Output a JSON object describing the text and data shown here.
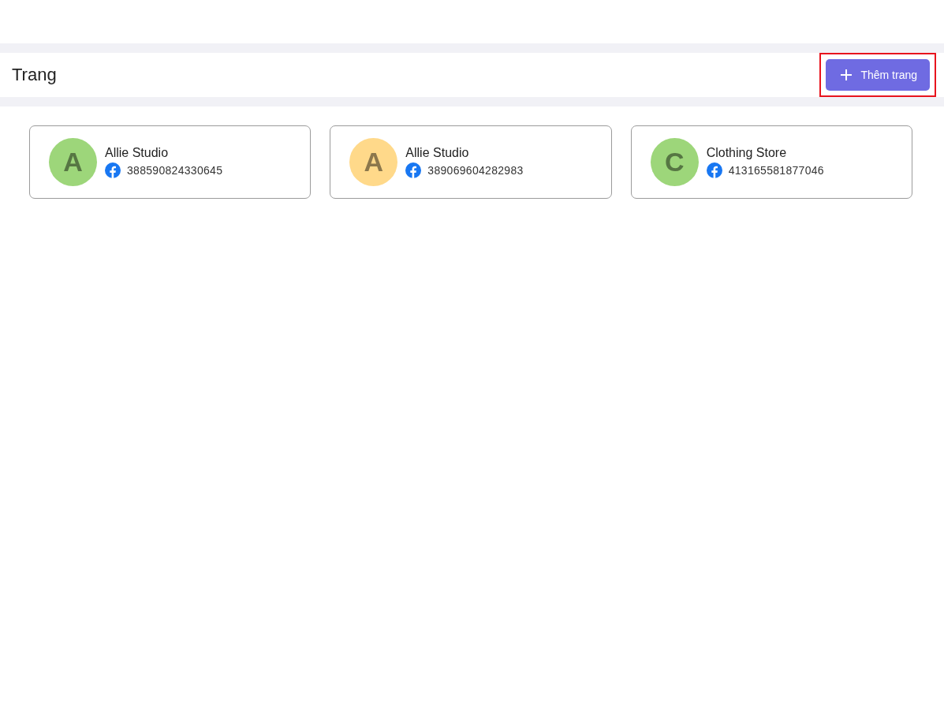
{
  "header": {
    "title": "Trang",
    "add_button": {
      "label": "Thêm trang",
      "highlighted": true
    }
  },
  "pages": [
    {
      "avatar_letter": "A",
      "color": "#9dd67a",
      "name": "Allie Studio",
      "page_id": "388590824330645"
    },
    {
      "avatar_letter": "A",
      "color": "#ffd98a",
      "name": "Allie Studio",
      "page_id": "389069604282983"
    },
    {
      "avatar_letter": "C",
      "color": "#9dd67a",
      "name": "Clothing Store",
      "page_id": "413165581877046"
    }
  ]
}
